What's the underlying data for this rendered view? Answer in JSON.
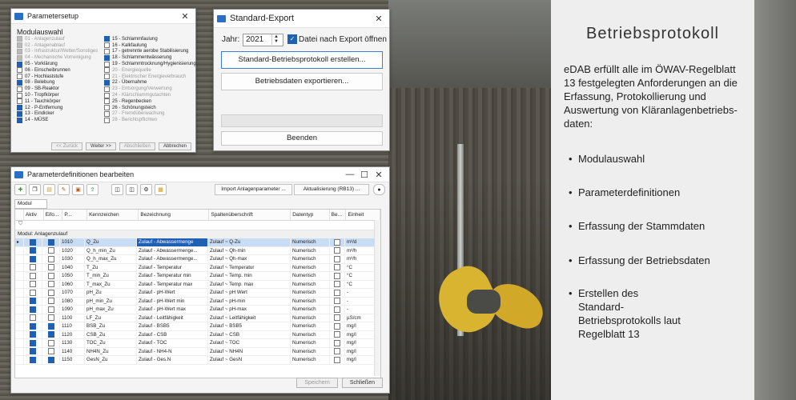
{
  "background": {
    "description_colors": {
      "wall": "#5c5850",
      "propeller": "#d9b430"
    }
  },
  "panel": {
    "title": "Betriebsprotokoll",
    "lead": "eDAB erfüllt alle im ÖWAV-Regelblatt 13 festgelegten Anforderungen an die Erfassung, Protokollierung und Auswertung von Kläranlagenbetriebs-daten:",
    "bullets": [
      "Modulauswahl",
      "Parameterdefinitionen",
      "Erfassung der Stammdaten",
      "Erfassung der Betriebsdaten",
      "Erstellen des Standard-Betriebsprotokolls laut Regelblatt 13"
    ]
  },
  "parametersetup": {
    "title": "Parametersetup",
    "section": "Modulauswahl",
    "col1": [
      {
        "label": "01 - Anlagenzulauf",
        "state": "disabled"
      },
      {
        "label": "02 - Anlagenablauf",
        "state": "disabled"
      },
      {
        "label": "03 - Infrastruktur/Wetter/Sonstiges",
        "state": "disabled"
      },
      {
        "label": "04 - Mechanische Vorreinigung",
        "state": "disabled"
      },
      {
        "label": "05 - Vorklärung",
        "state": "on"
      },
      {
        "label": "06 - Einscheibrunnen",
        "state": "off"
      },
      {
        "label": "07 - Hochlaststufe",
        "state": "off"
      },
      {
        "label": "08 - Belebung",
        "state": "on"
      },
      {
        "label": "09 - SB-Reaktor",
        "state": "off"
      },
      {
        "label": "10 - Tropfkörper",
        "state": "off"
      },
      {
        "label": "11 - Tauchkörper",
        "state": "off"
      },
      {
        "label": "12 - P-Entfernung",
        "state": "on"
      },
      {
        "label": "13 - Eindicker",
        "state": "on"
      },
      {
        "label": "14 - MÜSE",
        "state": "on"
      }
    ],
    "col2": [
      {
        "label": "15 - Schlammfaulung",
        "state": "on"
      },
      {
        "label": "16 - Kalkfaulung",
        "state": "off"
      },
      {
        "label": "17 - getrennte aerobe Stabilisierung",
        "state": "off"
      },
      {
        "label": "18 - Schlammentwässerung",
        "state": "on"
      },
      {
        "label": "19 - Schlammtrocknung/Hygienisierung",
        "state": "off"
      },
      {
        "label": "20 - Energiequelle",
        "state": "dim"
      },
      {
        "label": "21 - Elektrischer Energieverbrauch",
        "state": "dim"
      },
      {
        "label": "22 - Übernahme",
        "state": "on"
      },
      {
        "label": "23 - Entsorgung/Verwertung",
        "state": "dim"
      },
      {
        "label": "24 - Klärschlammgutachten",
        "state": "dim"
      },
      {
        "label": "25 - Regenbecken",
        "state": "off"
      },
      {
        "label": "26 - Schönungsteich",
        "state": "off"
      },
      {
        "label": "27 - Fremdüberwachung",
        "state": "dim"
      },
      {
        "label": "28 - Berichtspflichten",
        "state": "dim"
      }
    ],
    "buttons": {
      "back": "<< Zurück",
      "next": "Weiter >>",
      "finish": "Abschließen",
      "cancel": "Abbrechen"
    }
  },
  "export": {
    "title": "Standard-Export",
    "year_label": "Jahr:",
    "year_value": "2021",
    "open_after_label": "Datei nach Export öffnen",
    "btn_create": "Standard-Betriebsprotokoll erstellen...",
    "btn_export": "Betriebsdaten exportieren...",
    "btn_quit": "Beenden"
  },
  "paramdef": {
    "title": "Parameterdefinitionen bearbeiten",
    "btn_import": "Import Anlagenparameter ...",
    "btn_update": "Aktualisierung (RB13) ...",
    "group_box": "Modul",
    "columns": [
      "Aktiv",
      "Eifo...",
      "P...",
      "Kennzeichen",
      "Bezeichnung",
      "Spaltenüberschrift",
      "Datentyp",
      "Be...",
      "Einheit"
    ],
    "group_row": "Modul:  Anlagenzulauf",
    "rows": [
      {
        "aktiv": true,
        "eifo": true,
        "p": "1010",
        "kz": "Q_Zu",
        "bez": "Zulauf - Abwassermenge",
        "sp": "Zulauf ~ Q-Zu",
        "dt": "Numerisch",
        "be": false,
        "eh": "m³/d",
        "sel": true
      },
      {
        "aktiv": true,
        "eifo": false,
        "p": "1020",
        "kz": "Q_h_min_Zu",
        "bez": "Zulauf - Abwassermenge...",
        "sp": "Zulauf ~ Qh-min",
        "dt": "Numerisch",
        "be": false,
        "eh": "m³/h"
      },
      {
        "aktiv": true,
        "eifo": false,
        "p": "1030",
        "kz": "Q_h_max_Zu",
        "bez": "Zulauf - Abwassermenge...",
        "sp": "Zulauf ~ Qh-max",
        "dt": "Numerisch",
        "be": false,
        "eh": "m³/h"
      },
      {
        "aktiv": false,
        "eifo": false,
        "p": "1040",
        "kz": "T_Zu",
        "bez": "Zulauf - Temperatur",
        "sp": "Zulauf ~ Temperatur",
        "dt": "Numerisch",
        "be": false,
        "eh": "°C"
      },
      {
        "aktiv": false,
        "eifo": false,
        "p": "1050",
        "kz": "T_min_Zu",
        "bez": "Zulauf - Temperatur min",
        "sp": "Zulauf ~ Temp. min",
        "dt": "Numerisch",
        "be": false,
        "eh": "°C"
      },
      {
        "aktiv": false,
        "eifo": false,
        "p": "1060",
        "kz": "T_max_Zu",
        "bez": "Zulauf - Temperatur max",
        "sp": "Zulauf ~ Temp. max",
        "dt": "Numerisch",
        "be": false,
        "eh": "°C"
      },
      {
        "aktiv": false,
        "eifo": false,
        "p": "1070",
        "kz": "pH_Zu",
        "bez": "Zulauf - pH-Wert",
        "sp": "Zulauf ~ pH Wert",
        "dt": "Numerisch",
        "be": false,
        "eh": "-"
      },
      {
        "aktiv": true,
        "eifo": false,
        "p": "1080",
        "kz": "pH_min_Zu",
        "bez": "Zulauf - pH-Wert min",
        "sp": "Zulauf ~ pH-min",
        "dt": "Numerisch",
        "be": false,
        "eh": "-"
      },
      {
        "aktiv": true,
        "eifo": false,
        "p": "1090",
        "kz": "pH_max_Zu",
        "bez": "Zulauf - pH-Wert max",
        "sp": "Zulauf ~ pH-max",
        "dt": "Numerisch",
        "be": false,
        "eh": "-"
      },
      {
        "aktiv": false,
        "eifo": false,
        "p": "1100",
        "kz": "LF_Zu",
        "bez": "Zulauf - Leitfähigkeit",
        "sp": "Zulauf ~ Leitfähigkeit",
        "dt": "Numerisch",
        "be": false,
        "eh": "µS/cm"
      },
      {
        "aktiv": true,
        "eifo": true,
        "p": "1110",
        "kz": "BSB_Zu",
        "bez": "Zulauf - BSB5",
        "sp": "Zulauf ~ BSB5",
        "dt": "Numerisch",
        "be": false,
        "eh": "mg/l"
      },
      {
        "aktiv": true,
        "eifo": true,
        "p": "1120",
        "kz": "CSB_Zu",
        "bez": "Zulauf - CSB",
        "sp": "Zulauf ~ CSB",
        "dt": "Numerisch",
        "be": false,
        "eh": "mg/l"
      },
      {
        "aktiv": true,
        "eifo": false,
        "p": "1130",
        "kz": "TOC_Zu",
        "bez": "Zulauf - TOC",
        "sp": "Zulauf ~ TOC",
        "dt": "Numerisch",
        "be": false,
        "eh": "mg/l"
      },
      {
        "aktiv": true,
        "eifo": false,
        "p": "1140",
        "kz": "NH4N_Zu",
        "bez": "Zulauf - NH4-N",
        "sp": "Zulauf ~ NH4N",
        "dt": "Numerisch",
        "be": false,
        "eh": "mg/l"
      },
      {
        "aktiv": true,
        "eifo": true,
        "p": "1150",
        "kz": "GesN_Zu",
        "bez": "Zulauf - Ges.N",
        "sp": "Zulauf ~ GesN",
        "dt": "Numerisch",
        "be": false,
        "eh": "mg/l"
      }
    ],
    "btn_save": "Speichern",
    "btn_close": "Schließen"
  }
}
